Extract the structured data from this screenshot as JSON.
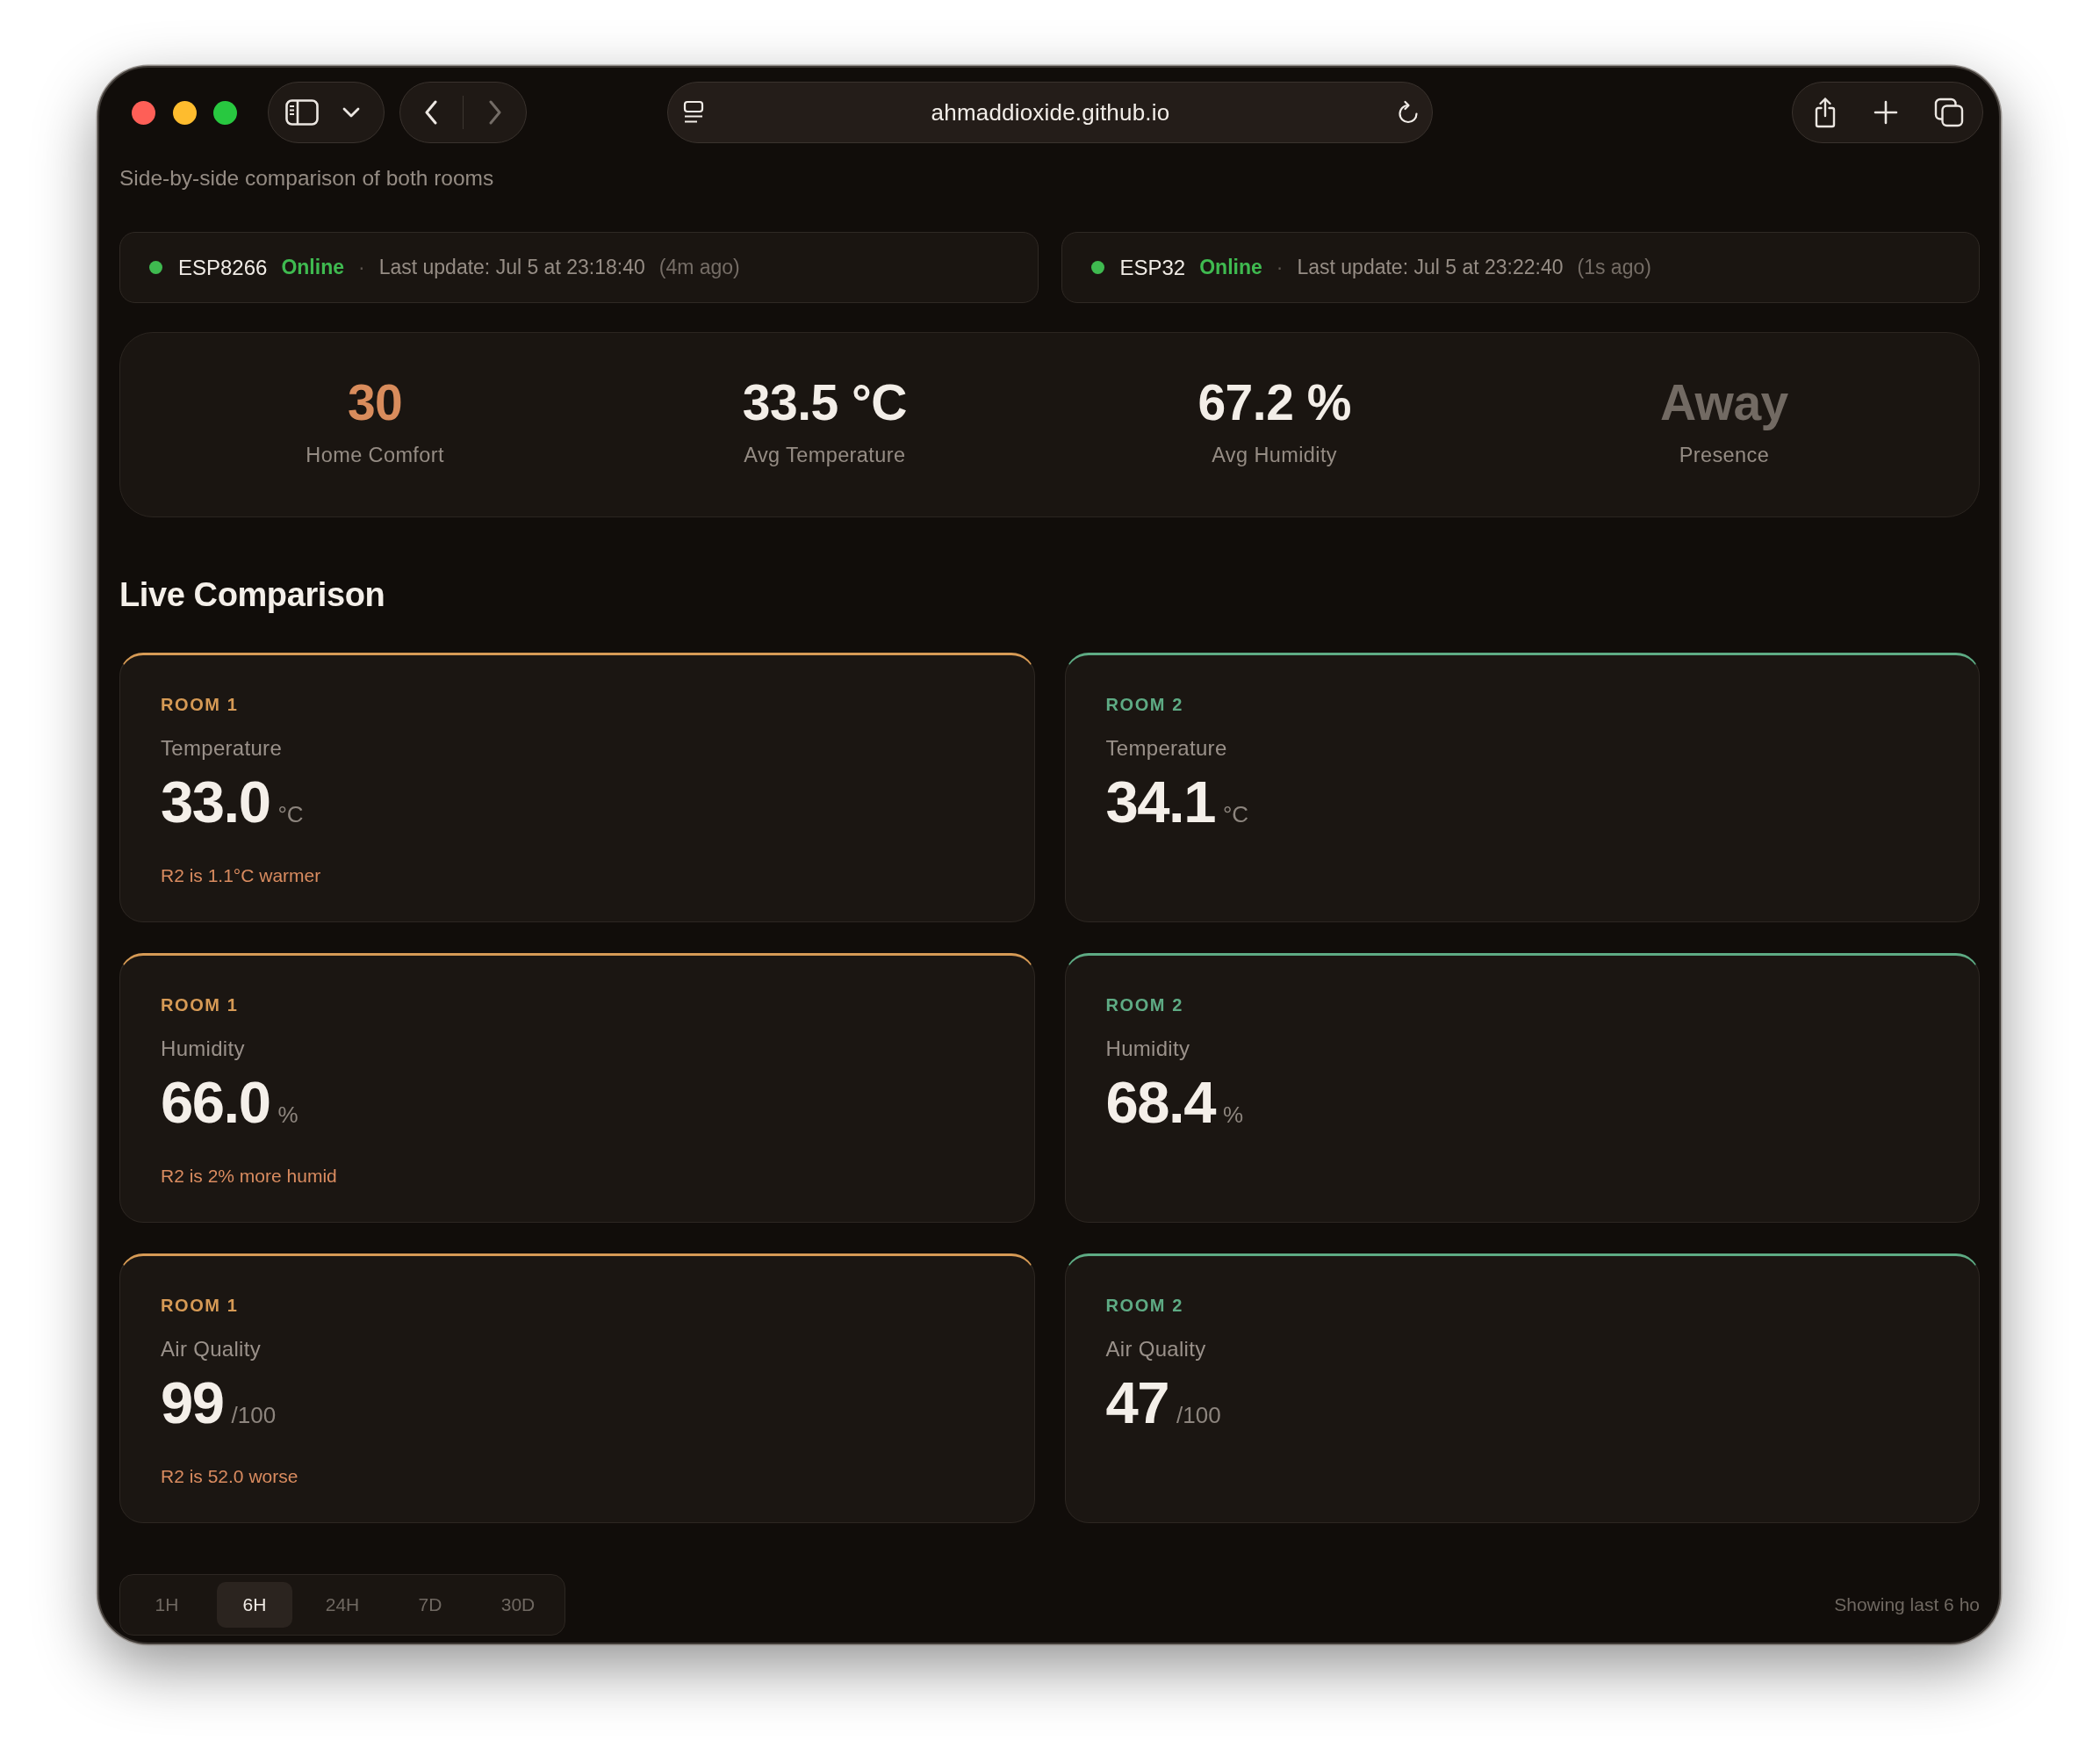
{
  "browser": {
    "url": "ahmaddioxide.github.io",
    "nav_buttons": [
      {
        "kind": "back",
        "disabled": false
      },
      {
        "kind": "forward",
        "disabled": true
      }
    ]
  },
  "page": {
    "subtitle": "Side-by-side comparison of both rooms"
  },
  "devices": [
    {
      "name": "ESP8266",
      "online": true,
      "status": "Online",
      "separator": "·",
      "last_update": "Last update: Jul 5 at 23:18:40",
      "ago": "(4m ago)"
    },
    {
      "name": "ESP32",
      "online": true,
      "status": "Online",
      "separator": "·",
      "last_update": "Last update: Jul 5 at 23:22:40",
      "ago": "(1s ago)"
    }
  ],
  "summary": [
    {
      "kind": "accent",
      "value": "30",
      "label": "Home Comfort"
    },
    {
      "kind": "plain",
      "value": "33.5 °C",
      "label": "Avg Temperature"
    },
    {
      "kind": "plain",
      "value": "67.2 %",
      "label": "Avg Humidity"
    },
    {
      "kind": "muted",
      "value": "Away",
      "label": "Presence"
    }
  ],
  "live_comparison": {
    "title": "Live Comparison",
    "cards": [
      {
        "room": "ROOM 1",
        "color": "#d69a55",
        "metric": "Temperature",
        "value": "33.0",
        "unit": "°C",
        "note": "R2 is 1.1°C warmer"
      },
      {
        "room": "ROOM 2",
        "color": "#5eab84",
        "metric": "Temperature",
        "value": "34.1",
        "unit": "°C"
      },
      {
        "room": "ROOM 1",
        "color": "#d69a55",
        "metric": "Humidity",
        "value": "66.0",
        "unit": "%",
        "note": "R2 is 2% more humid"
      },
      {
        "room": "ROOM 2",
        "color": "#5eab84",
        "metric": "Humidity",
        "value": "68.4",
        "unit": "%"
      },
      {
        "room": "ROOM 1",
        "color": "#d69a55",
        "metric": "Air Quality",
        "value": "99",
        "unit": "/100",
        "note": "R2 is 52.0 worse"
      },
      {
        "room": "ROOM 2",
        "color": "#5eab84",
        "metric": "Air Quality",
        "value": "47",
        "unit": "/100"
      }
    ]
  },
  "range": {
    "tabs": [
      {
        "label": "1H",
        "selected": false
      },
      {
        "label": "6H",
        "selected": true
      },
      {
        "label": "24H",
        "selected": false
      },
      {
        "label": "7D",
        "selected": false
      },
      {
        "label": "30D",
        "selected": false
      }
    ],
    "note": "Showing last 6 ho"
  }
}
